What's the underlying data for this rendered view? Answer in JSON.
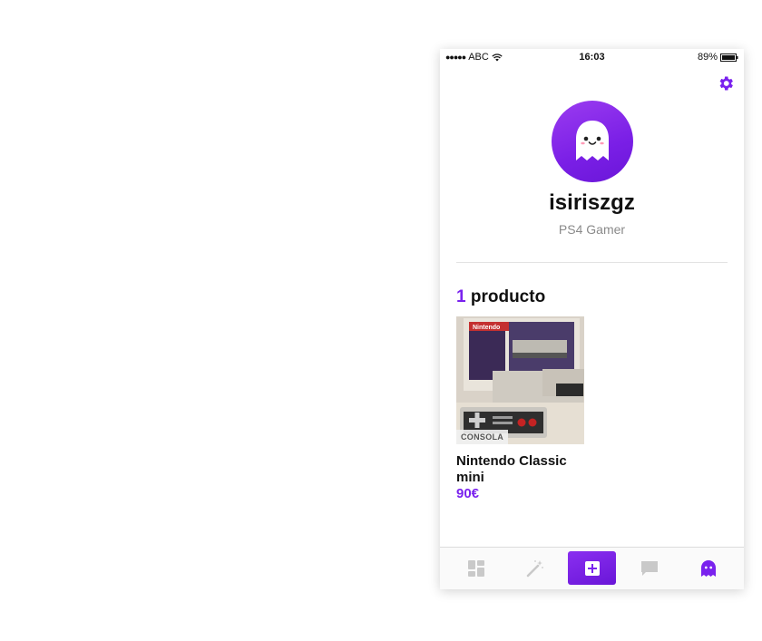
{
  "statusbar": {
    "carrier": "ABC",
    "time": "16:03",
    "battery": "89%"
  },
  "profile": {
    "username": "isiriszgz",
    "bio": "PS4 Gamer"
  },
  "products": {
    "count": "1",
    "label": "producto",
    "items": [
      {
        "category": "CONSOLA",
        "title": "Nintendo Classic mini",
        "price": "90€"
      }
    ]
  },
  "icons": {
    "settings": "gear-icon",
    "tabs": [
      "dashboard-icon",
      "magic-wand-icon",
      "add-product-icon",
      "chat-icon",
      "ghost-profile-icon"
    ]
  },
  "colors": {
    "accent": "#7a22ee",
    "muted": "#8a8a8a"
  }
}
